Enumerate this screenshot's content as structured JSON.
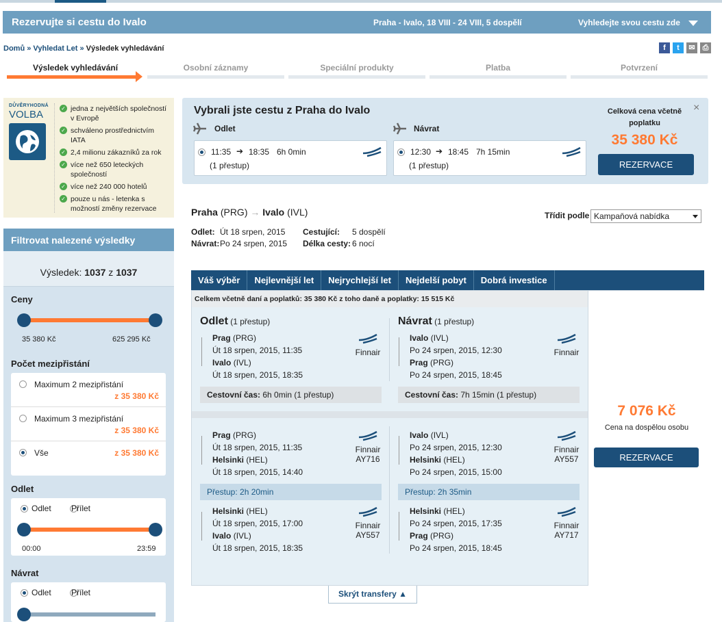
{
  "header": {
    "title": "Rezervujte si cestu do Ivalo",
    "summary": "Praha - Ivalo, 18 VIII - 24 VIII, 5 dospělí",
    "search_link": "Vyhledejte svou cestu zde"
  },
  "breadcrumb": {
    "home": "Domů",
    "sep1": "»",
    "search": "Vyhledat Let",
    "sep2": "»",
    "current": "Výsledek vyhledávání"
  },
  "share": {
    "fb": "f",
    "tw": "t",
    "mail": "✉",
    "print": "⎙"
  },
  "steps": [
    "Výsledek vyhledávání",
    "Osobní záznamy",
    "Speciální produkty",
    "Platba",
    "Potvrzení"
  ],
  "trust": {
    "logo_top": "DŮVĚRYHODNÁ",
    "logo_main": "VOLBA",
    "items": [
      "jedna z největších společností v Evropě",
      "schváleno prostřednictvím IATA",
      "2,4 milionu zákazníků za rok",
      "více než 650 leteckých společností",
      "více než 240 000 hotelů",
      "pouze u nás - letenka s možností změny rezervace"
    ]
  },
  "filter": {
    "title": "Filtrovat nalezené výsledky",
    "count_label": "Výsledek:",
    "count_shown": "1037",
    "count_of": "z",
    "count_total": "1037",
    "prices": {
      "title": "Ceny",
      "min": "35 380 Kč",
      "max": "625 295 Kč"
    },
    "stops": {
      "title": "Počet mezipřistání",
      "options": [
        {
          "label": "Maximum 2 mezipřistání",
          "price": "z 35 380 Kč"
        },
        {
          "label": "Maximum 3 mezipřistání",
          "price": "z 35 380 Kč"
        },
        {
          "label": "Vše",
          "price": "z 35 380 Kč"
        }
      ]
    },
    "departure": {
      "title": "Odlet",
      "opt1": "Odlet",
      "opt2": "Přílet",
      "from": "00:00",
      "to": "23:59"
    },
    "return": {
      "title": "Návrat",
      "opt1": "Odlet",
      "opt2": "Přílet"
    }
  },
  "selection": {
    "title": "Vybrali jste cestu z Praha do Ivalo",
    "out_label": "Odlet",
    "ret_label": "Návrat",
    "out": {
      "dep": "11:35",
      "arr": "18:35",
      "dur": "6h 0min",
      "stops": "(1 přestup)"
    },
    "ret": {
      "dep": "12:30",
      "arr": "18:45",
      "dur": "7h 15min",
      "stops": "(1 přestup)"
    },
    "total_label": "Celková cena včetně poplatku",
    "total_price": "35 380 Kč",
    "book": "REZERVACE",
    "close": "×"
  },
  "route": {
    "from": "Praha",
    "from_code": "(PRG)",
    "to": "Ivalo",
    "to_code": "(IVL)"
  },
  "meta": {
    "dep_label": "Odlet:",
    "dep_val": "Út 18 srpen, 2015",
    "ret_label": "Návrat:",
    "ret_val": "Po 24 srpen, 2015",
    "pax_label": "Cestující:",
    "pax_val": "5 dospělí",
    "len_label": "Délka cesty:",
    "len_val": "6 nocí"
  },
  "sort": {
    "label": "Třídit podle",
    "value": "Kampaňová nabídka"
  },
  "tabs": [
    "Váš výběr",
    "Nejlevnější let",
    "Nejrychlejší let",
    "Nejdelší pobyt",
    "Dobrá investice"
  ],
  "result": {
    "summary": "Celkem včetně daní a poplatků: 35 380 Kč z toho daně a poplatky: 15 515 Kč",
    "out_title": "Odlet",
    "ret_title": "Návrat",
    "stops": "(1 přestup)",
    "out": {
      "from": "Prag",
      "from_code": "(PRG)",
      "from_time": "Út 18 srpen, 2015, 11:35",
      "to": "Ivalo",
      "to_code": "(IVL)",
      "to_time": "Út 18 srpen, 2015, 18:35",
      "airline": "Finnair",
      "travel_label": "Cestovní čas:",
      "travel_val": "6h 0min (1 přestup)"
    },
    "ret": {
      "from": "Ivalo",
      "from_code": "(IVL)",
      "from_time": "Po 24 srpen, 2015, 12:30",
      "to": "Prag",
      "to_code": "(PRG)",
      "to_time": "Po 24 srpen, 2015, 18:45",
      "airline": "Finnair",
      "travel_label": "Cestovní čas:",
      "travel_val": "7h 15min (1 přestup)"
    },
    "out_legs": [
      {
        "from": "Prag",
        "from_code": "(PRG)",
        "from_time": "Út 18 srpen, 2015, 11:35",
        "to": "Helsinki",
        "to_code": "(HEL)",
        "to_time": "Út 18 srpen, 2015, 14:40",
        "airline": "Finnair",
        "flight": "AY716"
      },
      {
        "from": "Helsinki",
        "from_code": "(HEL)",
        "from_time": "Út 18 srpen, 2015, 17:00",
        "to": "Ivalo",
        "to_code": "(IVL)",
        "to_time": "Út 18 srpen, 2015, 18:35",
        "airline": "Finnair",
        "flight": "AY557"
      }
    ],
    "ret_legs": [
      {
        "from": "Ivalo",
        "from_code": "(IVL)",
        "from_time": "Po 24 srpen, 2015, 12:30",
        "to": "Helsinki",
        "to_code": "(HEL)",
        "to_time": "Po 24 srpen, 2015, 15:00",
        "airline": "Finnair",
        "flight": "AY557"
      },
      {
        "from": "Helsinki",
        "from_code": "(HEL)",
        "from_time": "Po 24 srpen, 2015, 17:35",
        "to": "Prag",
        "to_code": "(PRG)",
        "to_time": "Po 24 srpen, 2015, 18:45",
        "airline": "Finnair",
        "flight": "AY717"
      }
    ],
    "out_transfer": "Přestup: 2h 20min",
    "ret_transfer": "Přestup: 2h 35min",
    "price": "7 076 Kč",
    "price_label": "Cena na dospělou osobu",
    "book": "REZERVACE"
  },
  "hide_transfers": "Skrýt transfery ▲",
  "colors": {
    "primary": "#1c4f7a",
    "accent": "#ff7a33",
    "header": "#6e9fc0",
    "panel": "#d8e6f0"
  }
}
